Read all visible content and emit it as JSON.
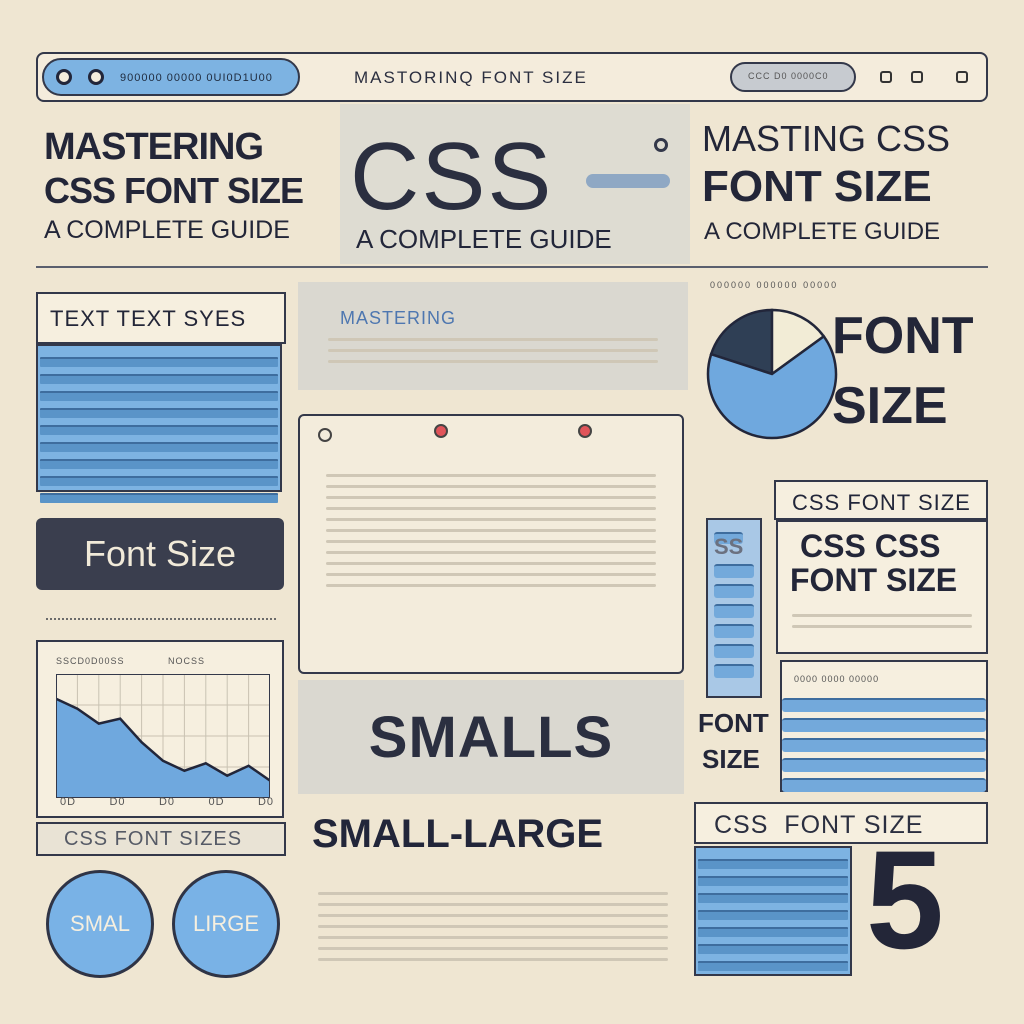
{
  "topbar": {
    "url_text": "900000 00000 0UI0D1U00",
    "title": "MASTORINQ FONT SIZE",
    "search_text": "CCC D0 0000C0",
    "icons": [
      "dot-icon",
      "dot-icon",
      "bell-icon",
      "menu-icon",
      "mail-icon",
      "circle-icon"
    ]
  },
  "hero_left": {
    "line1": "MASTERING",
    "line2": "CSS FONT SIZE",
    "line3": "A COMPLETE GUIDE"
  },
  "hero_center": {
    "big": "CSS",
    "sub": "A COMPLETE GUIDE"
  },
  "hero_right": {
    "line1": "MASTING CSS",
    "line2": "FONT SIZE",
    "line3": "A COMPLETE GUIDE"
  },
  "left_col": {
    "text_sizes_title": "TEXT TEXT SYES",
    "font_size_button": "Font Size",
    "chart_label_left": "SSCD0D00SS",
    "chart_label_right": "NOCSS",
    "chart_ticks": [
      "0D",
      "D0",
      "D0",
      "0D",
      "D0"
    ],
    "css_font_sizes": "CSS FONT SIZES",
    "small_btn": "SMAL",
    "large_btn": "LIRGE"
  },
  "center_col": {
    "mastering_label": "MASTERING",
    "smalls": "SMALLS",
    "small_large": "SMALL-LARGE"
  },
  "right_col": {
    "font": "FONT",
    "size": "SIZE",
    "css_font_size_top": "CSS FONT SIZE",
    "css_css": "CSS CSS",
    "font_size": "FONT SIZE",
    "font_small": "FONT",
    "size_small": "SIZE",
    "css_font_size_bottom": "CSS  FONT SIZE",
    "number": "5",
    "header_text": "000000 000000 00000",
    "sub_label": "SS",
    "bar_label": "0000 0000 00000"
  },
  "chart_data": {
    "type": "area",
    "x": [
      0,
      1,
      2,
      3,
      4,
      5,
      6,
      7,
      8,
      9,
      10
    ],
    "values": [
      80,
      72,
      60,
      64,
      45,
      30,
      22,
      28,
      18,
      26,
      14
    ],
    "ylim": [
      0,
      100
    ],
    "title": "",
    "xlabel": "",
    "ylabel": ""
  },
  "pie_data": {
    "type": "pie",
    "values": [
      65,
      20,
      15
    ],
    "colors": [
      "#6fa8de",
      "#2f3f55",
      "#f2ecd6"
    ]
  },
  "colors": {
    "accent": "#6fa8de",
    "dark": "#232638",
    "background": "#efe6d2"
  }
}
